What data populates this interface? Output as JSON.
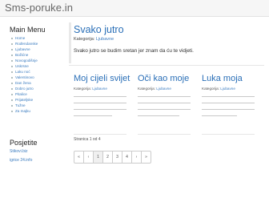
{
  "brand": "Sms-poruke.in",
  "sidebar": {
    "title": "Main Menu",
    "items": [
      "Home",
      "Rođendanske",
      "Ljubavne",
      "Božićne",
      "Novogodišnje",
      "Uskrsne",
      "Laku noć",
      "Valentinovo",
      "Dan žena",
      "Dobro jutro",
      "Pitalice",
      "Prijateljske",
      "Tužne",
      "Za majku"
    ],
    "title2": "Posjetite",
    "links": [
      "Stikovi.biz",
      "igrice 24.info"
    ]
  },
  "featured": {
    "title": "Svako jutro",
    "category_label": "Kategorija:",
    "category": "Ljubavne",
    "text": "Svako jutro se budim sretan jer znam da ću te vidjeti."
  },
  "cards": [
    {
      "title": "Moj cijeli svijet",
      "category_label": "Kategorija:",
      "category": "Ljubavne"
    },
    {
      "title": "Oči kao moje",
      "category_label": "Kategorija:",
      "category": "Ljubavne"
    },
    {
      "title": "Luka moja",
      "category_label": "Kategorija:",
      "category": "Ljubavne"
    }
  ],
  "pagination": {
    "info": "Stranica 1 od 4",
    "buttons": [
      "«",
      "‹",
      "1",
      "2",
      "3",
      "4",
      "›",
      "»"
    ],
    "current": "1"
  }
}
